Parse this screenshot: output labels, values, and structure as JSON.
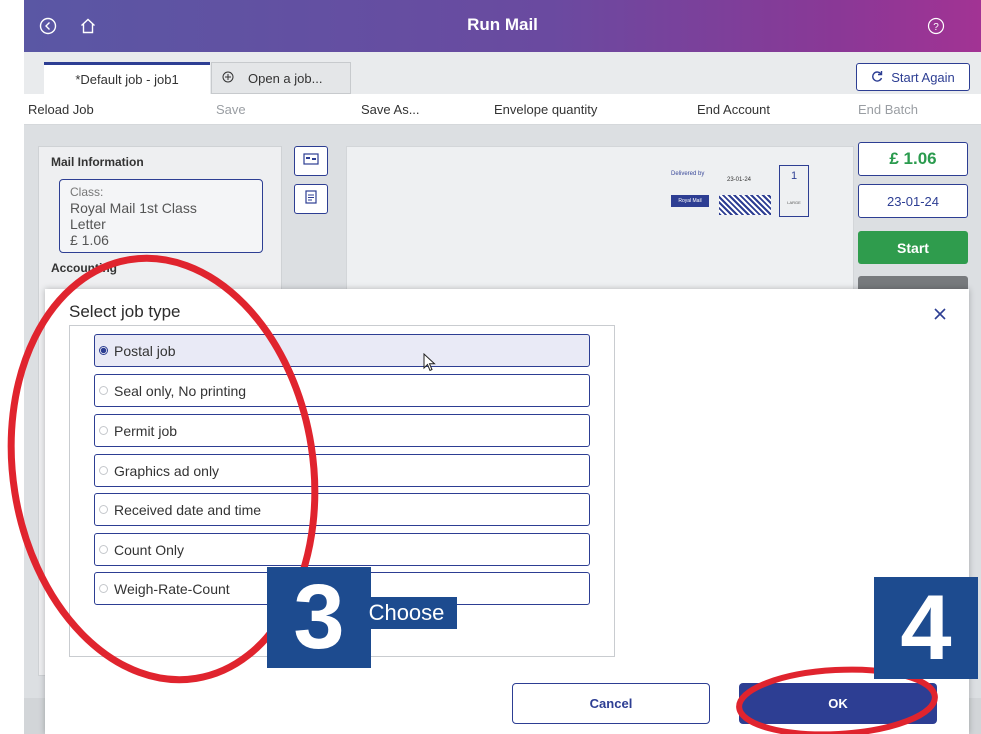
{
  "window": {
    "title": "Run Mail"
  },
  "titlebar": {
    "back_icon": "back-circle-icon",
    "home_icon": "home-icon",
    "help_icon": "help-icon"
  },
  "tabs": {
    "active_label": "*Default job - job1",
    "open_label": "Open a job...",
    "start_again_label": "Start Again"
  },
  "toolbar": {
    "items": [
      "Reload Job",
      "Save",
      "Save As...",
      "Envelope quantity",
      "End Account",
      "End Batch"
    ]
  },
  "mail_info": {
    "title": "Mail Information",
    "class_label": "Class:",
    "service": "Royal Mail 1st Class",
    "format": "Letter",
    "price": "£ 1.06",
    "accounting_title": "Accounting"
  },
  "preview": {
    "delivered_by": "Delivered by",
    "brand": "Royal Mail",
    "date": "23-01-24",
    "class_number": "1",
    "class_sub": "LARGE"
  },
  "side": {
    "price": "£ 1.06",
    "date": "23-01-24",
    "start_label": "Start"
  },
  "dialog": {
    "title": "Select job type",
    "options": [
      "Postal job",
      "Seal only, No printing",
      "Permit job",
      "Graphics ad only",
      "Received date and time",
      "Count Only",
      "Weigh-Rate-Count"
    ],
    "selected_index": 0,
    "cancel_label": "Cancel",
    "ok_label": "OK"
  },
  "annotations": {
    "step3_number": "3",
    "step3_text": "Choose",
    "step4_number": "4",
    "highlight_color": "#e0242e",
    "badge_color": "#1d4b8f"
  },
  "colors": {
    "accent": "#2d3e93",
    "start_green": "#2f9c4d",
    "price_green": "#2a9b4e"
  }
}
